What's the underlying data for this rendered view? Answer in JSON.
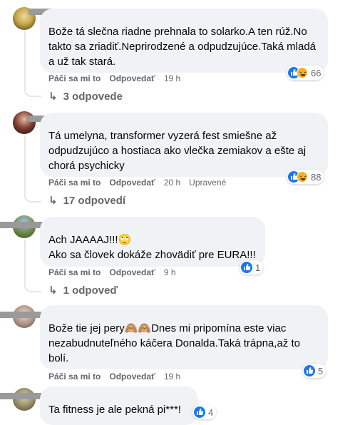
{
  "comments": [
    {
      "text": "Bože tá slečna riadne prehnala to solarko.A ten rúž.No takto sa zriadiť.Neprirodzené a odpudzujúce.Taká mladá a už tak stará.",
      "reaction_count": "66",
      "like": "Páči sa mi to",
      "reply": "Odpovedať",
      "time": "19 h",
      "replies": "3 odpovede"
    },
    {
      "text": "Tá umelyna, transformer vyzerá fest smiešne až odpudzujúco a hostiaca ako vlečka zemiakov a ešte aj chorá psychicky",
      "reaction_count": "88",
      "like": "Páči sa mi to",
      "reply": "Odpovedať",
      "time": "20 h",
      "edited": "Upravené",
      "replies": "17 odpovedí"
    },
    {
      "text_line1": "Ach JAAAAJ!!!🙄",
      "text_line2": "Ako sa človek dokáže zhovädiť pre EURA!!!",
      "reaction_count": "1",
      "like": "Páči sa mi to",
      "reply": "Odpovedať",
      "time": "9 h",
      "replies": "1 odpoveď"
    },
    {
      "text": "Bože tie jej pery🙈🙈Dnes mi pripomína este viac nezabudnuteľného káčera Donalda.Taká trápna,až to bolí.",
      "reaction_count": "5",
      "like": "Páči sa mi to",
      "reply": "Odpovedať",
      "time": "19 h"
    },
    {
      "text": "Ta fitness je ale pekná pi***!",
      "reaction_count": "4"
    }
  ],
  "colors": {
    "like": "#1877f2",
    "haha": "#f7b125",
    "bubble": "#f0f2f5",
    "meta": "#65676b"
  }
}
